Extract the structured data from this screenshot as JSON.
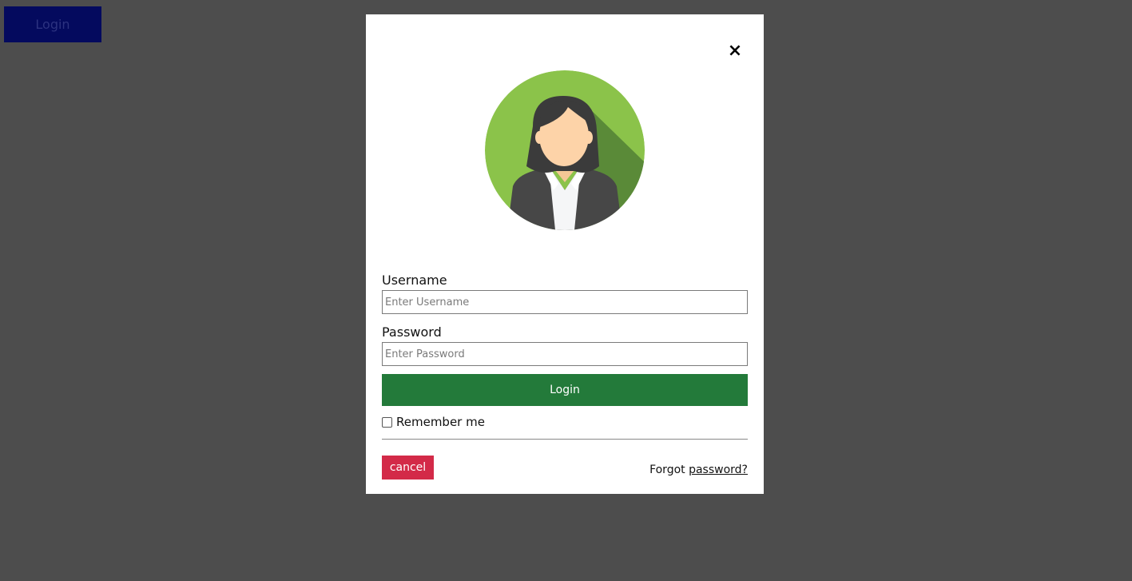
{
  "background": {
    "open_login_label": "Login",
    "overlay_color": "#4d4d4d",
    "open_login_color": "#040a5e"
  },
  "modal": {
    "close_symbol": "×",
    "avatar_icon": "avatar-woman-icon",
    "username": {
      "label": "Username",
      "placeholder": "Enter Username",
      "value": ""
    },
    "password": {
      "label": "Password",
      "placeholder": "Enter Password",
      "value": ""
    },
    "submit_label": "Login",
    "submit_color": "#237a3a",
    "remember_label": "Remember me",
    "remember_checked": false,
    "cancel_label": "cancel",
    "cancel_color": "#d32a48",
    "forgot_prefix": "Forgot",
    "forgot_link": "password?"
  }
}
